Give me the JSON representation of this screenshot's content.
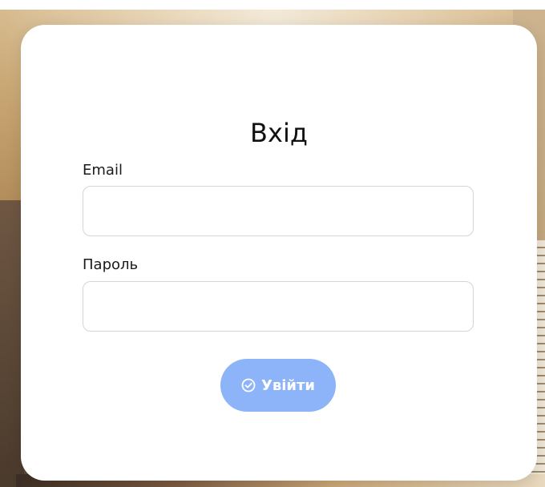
{
  "page": {
    "title": "Вхід"
  },
  "form": {
    "email_label": "Email",
    "email_value": "",
    "password_label": "Пароль",
    "password_value": "",
    "submit_label": "Увійти",
    "submit_icon": "check-circle-icon"
  },
  "colors": {
    "button_background": "#8db4f8",
    "card_background": "#ffffff",
    "field_border": "#d5d5d5"
  }
}
